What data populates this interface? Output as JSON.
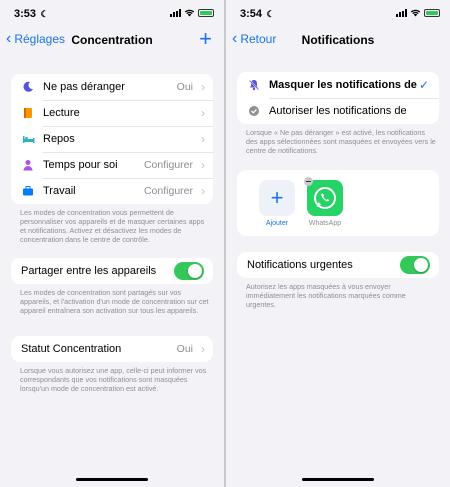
{
  "left": {
    "status": {
      "time": "3:53"
    },
    "nav": {
      "back": "Réglages",
      "title": "Concentration"
    },
    "focus_items": [
      {
        "label": "Ne pas déranger",
        "value": "Oui",
        "icon": "moon-icon"
      },
      {
        "label": "Lecture",
        "value": "",
        "icon": "book-icon"
      },
      {
        "label": "Repos",
        "value": "",
        "icon": "bed-icon"
      },
      {
        "label": "Temps pour soi",
        "value": "Configurer",
        "icon": "person-icon"
      },
      {
        "label": "Travail",
        "value": "Configurer",
        "icon": "briefcase-icon"
      }
    ],
    "focus_footer": "Les modes de concentration vous permettent de personnaliser vos appareils et de masquer certaines apps et notifications. Activez et désactivez les modes de concentration dans le centre de contrôle.",
    "share": {
      "label": "Partager entre les appareils",
      "on": true
    },
    "share_footer": "Les modes de concentration sont partagés sur vos appareils, et l'activation d'un mode de concentration sur cet appareil entraînera son activation sur tous les appareils.",
    "status_focus": {
      "label": "Statut Concentration",
      "value": "Oui"
    },
    "status_footer": "Lorsque vous autorisez une app, celle-ci peut informer vos correspondants que vos notifications sont masquées lorsqu'un mode de concentration est activé."
  },
  "right": {
    "status": {
      "time": "3:54"
    },
    "nav": {
      "back": "Retour",
      "title": "Notifications"
    },
    "options": [
      {
        "label": "Masquer les notifications de",
        "selected": true,
        "icon": "bell-slash-icon"
      },
      {
        "label": "Autoriser les notifications de",
        "selected": false,
        "icon": "check-badge-icon"
      }
    ],
    "options_footer": "Lorsque « Ne pas déranger » est activé, les notifications des apps sélectionnées sont masquées et envoyées vers le centre de notifications.",
    "apps": {
      "add_label": "Ajouter",
      "app_name": "WhatsApp"
    },
    "urgent": {
      "label": "Notifications urgentes",
      "on": true
    },
    "urgent_footer": "Autorisez les apps masquées à vous envoyer immédiatement les notifications marquées comme urgentes."
  },
  "colors": {
    "accent": "#1a73e8",
    "toggle_on": "#34c759",
    "background": "#f2f2f7"
  }
}
